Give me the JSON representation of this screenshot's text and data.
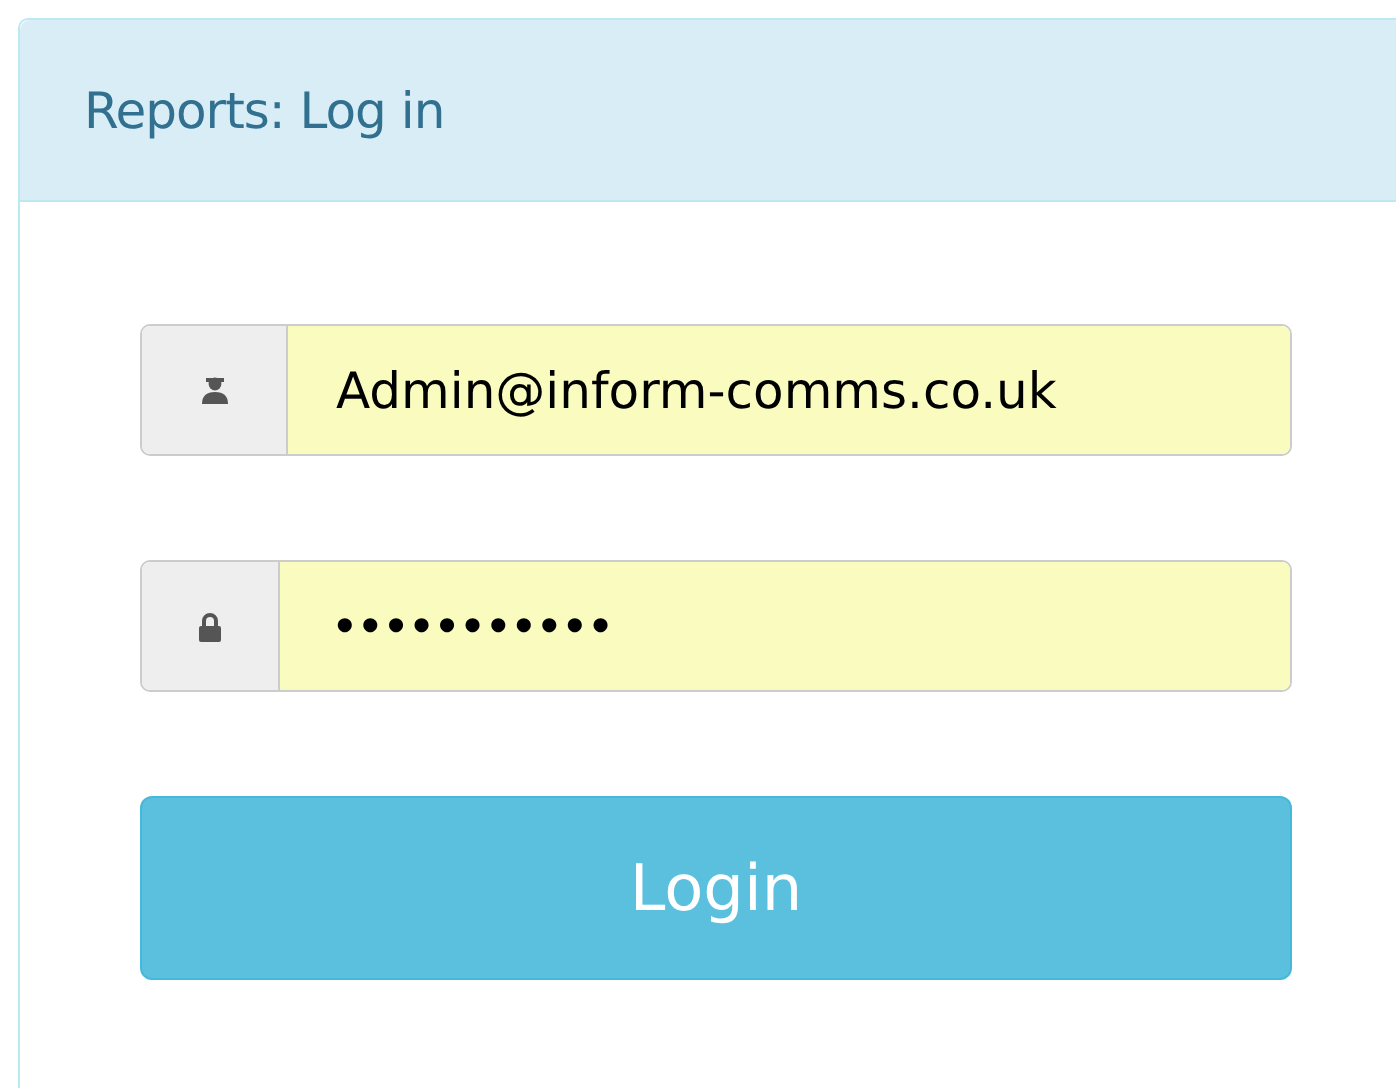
{
  "panel": {
    "title": "Reports: Log in"
  },
  "fields": [
    {
      "kind": "user",
      "value": "Admin@inform-comms.co.uk"
    },
    {
      "kind": "password",
      "value": "•••••••••••"
    }
  ],
  "button": {
    "label": "Login"
  }
}
